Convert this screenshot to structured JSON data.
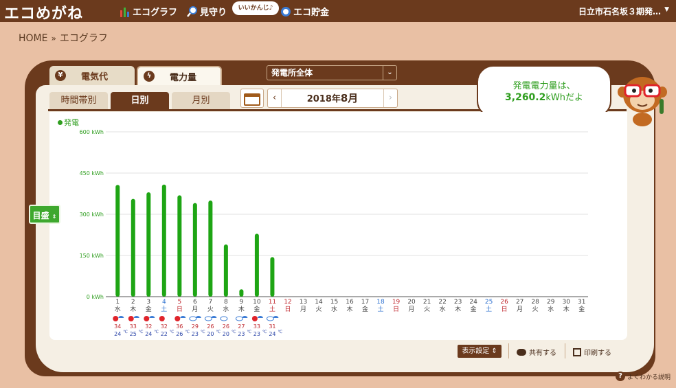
{
  "header": {
    "logo": "エコめがね",
    "nav": [
      {
        "label": "エコグラフ",
        "icon": "bar-chart-icon"
      },
      {
        "label": "見守り",
        "icon": "magnifier-icon"
      },
      {
        "label": "エコ貯金",
        "icon": "coin-icon"
      }
    ],
    "bubble": "いいかんじ♪",
    "location": "日立市石名坂３期発…"
  },
  "breadcrumb": {
    "home": "HOME",
    "sep": "»",
    "current": "エコグラフ"
  },
  "tabs": {
    "electricity_cost": "電気代",
    "power_amount": "電力量"
  },
  "plant_select": "発電所全体",
  "subtabs": [
    "時間帯別",
    "日別",
    "月別"
  ],
  "date": {
    "year": "2018年",
    "month": "8月",
    "prev": "‹",
    "next": "›"
  },
  "speech": {
    "line1": "発電電力量は、",
    "value": "3,260.2",
    "unit": "kWhだよ"
  },
  "scale_button": "目盛",
  "tools": {
    "display": "表示設定",
    "share": "共有する",
    "print": "印刷する"
  },
  "help": "よくわかる説明",
  "colors": {
    "bar": "#1ea514",
    "brown": "#6b3a1d",
    "saturday": "#2b6fcf",
    "sunday": "#c0292f"
  },
  "chart_data": {
    "type": "bar",
    "legend": "発電",
    "y_ticks": [
      "0 kWh",
      "150 kWh",
      "300 kWh",
      "450 kWh",
      "600 kWh"
    ],
    "ylim": [
      0,
      600
    ],
    "days": [
      "1",
      "2",
      "3",
      "4",
      "5",
      "6",
      "7",
      "8",
      "9",
      "10",
      "11",
      "12",
      "13",
      "14",
      "15",
      "16",
      "17",
      "18",
      "19",
      "20",
      "21",
      "22",
      "23",
      "24",
      "25",
      "26",
      "27",
      "28",
      "29",
      "30",
      "31"
    ],
    "weekdays": [
      "水",
      "木",
      "金",
      "土",
      "日",
      "月",
      "火",
      "水",
      "木",
      "金",
      "土",
      "日",
      "月",
      "火",
      "水",
      "木",
      "金",
      "土",
      "日",
      "月",
      "火",
      "水",
      "木",
      "金",
      "土",
      "日",
      "月",
      "火",
      "水",
      "木",
      "金"
    ],
    "holidays": [
      11,
      12
    ],
    "values": [
      407,
      356,
      380,
      408,
      369,
      341,
      350,
      190,
      27,
      229,
      144
    ],
    "weather": [
      "sunny-cloudy",
      "sunny-rainy",
      "sunny-cloudy",
      "sunny",
      "sunny-cloudy",
      "cloudy-rainy",
      "cloudy-rainy",
      "rainy",
      "cloudy-rainy",
      "sunny-cloudy",
      "cloudy-rainy"
    ],
    "temp_high": [
      34,
      33,
      32,
      32,
      36,
      29,
      26,
      26,
      27,
      33,
      31
    ],
    "temp_low": [
      24,
      25,
      24,
      22,
      26,
      23,
      20,
      20,
      23,
      23,
      24
    ],
    "temp_unit": "℃"
  }
}
